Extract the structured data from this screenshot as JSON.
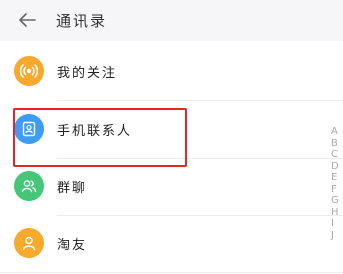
{
  "header": {
    "title": "通讯录",
    "back_icon": "back-arrow-icon"
  },
  "items": [
    {
      "label": "我的关注",
      "icon": "radio-signal-icon",
      "color": "#f8a92d"
    },
    {
      "label": "手机联系人",
      "icon": "contact-card-icon",
      "color": "#3e9cf4"
    },
    {
      "label": "群聊",
      "icon": "group-people-icon",
      "color": "#45c777"
    },
    {
      "label": "淘友",
      "icon": "person-icon",
      "color": "#f8aa2c"
    }
  ],
  "index": [
    "A",
    "B",
    "C",
    "D",
    "E",
    "F",
    "G",
    "H",
    "I",
    "J"
  ],
  "highlight_color": "#e4252c"
}
